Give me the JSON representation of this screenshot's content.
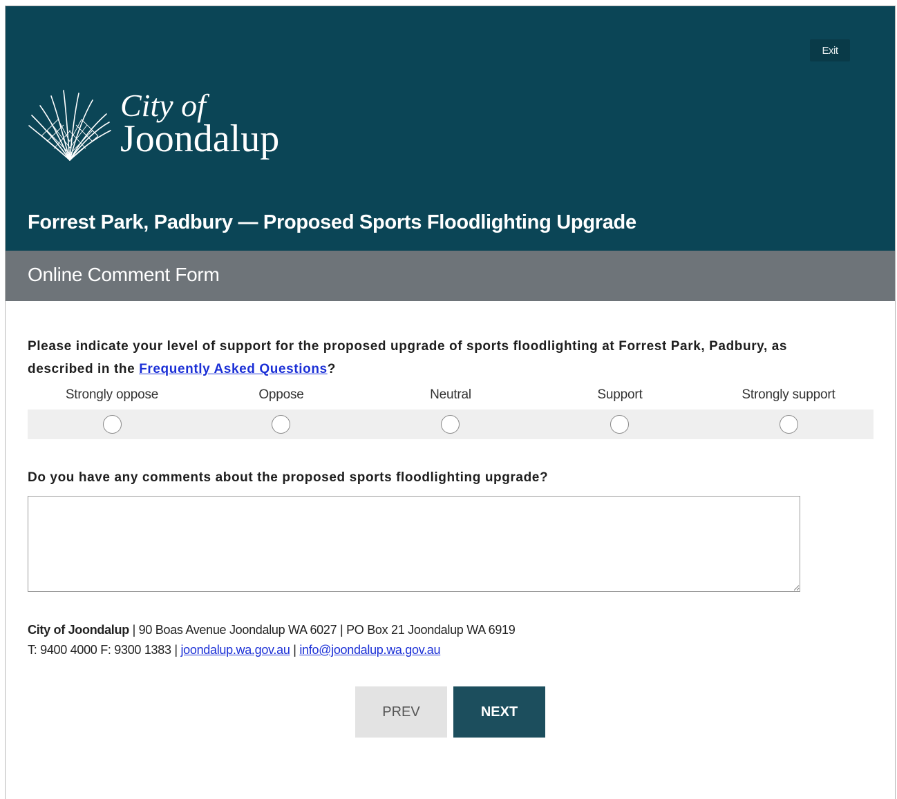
{
  "header": {
    "exit_label": "Exit",
    "logo_line1": "City of",
    "logo_line2": "Joondalup",
    "title": "Forrest Park, Padbury — Proposed Sports Floodlighting Upgrade"
  },
  "subheader": {
    "title": "Online Comment Form"
  },
  "question1": {
    "text_before": "Please indicate your level of support for the proposed upgrade of sports floodlighting at Forrest Park, Padbury, as described in the ",
    "link_text": "Frequently Asked Questions",
    "text_after": "?",
    "options": [
      "Strongly oppose",
      "Oppose",
      "Neutral",
      "Support",
      "Strongly support"
    ],
    "selected": null
  },
  "question2": {
    "text": "Do you have any comments about the proposed sports floodlighting upgrade?",
    "value": ""
  },
  "footer": {
    "org": "City of Joondalup",
    "address": " | 90 Boas Avenue Joondalup WA 6027 | PO Box 21 Joondalup WA 6919",
    "phone": "T: 9400 4000 F: 9300 1383 | ",
    "website": "joondalup.wa.gov.au",
    "separator": " | ",
    "email": "info@joondalup.wa.gov.au"
  },
  "nav": {
    "prev_label": "PREV",
    "next_label": "NEXT"
  },
  "colors": {
    "header_bg": "#0b4556",
    "subheader_bg": "#6e7479",
    "next_bg": "#1c4e5d",
    "link": "#1a2fd6"
  }
}
